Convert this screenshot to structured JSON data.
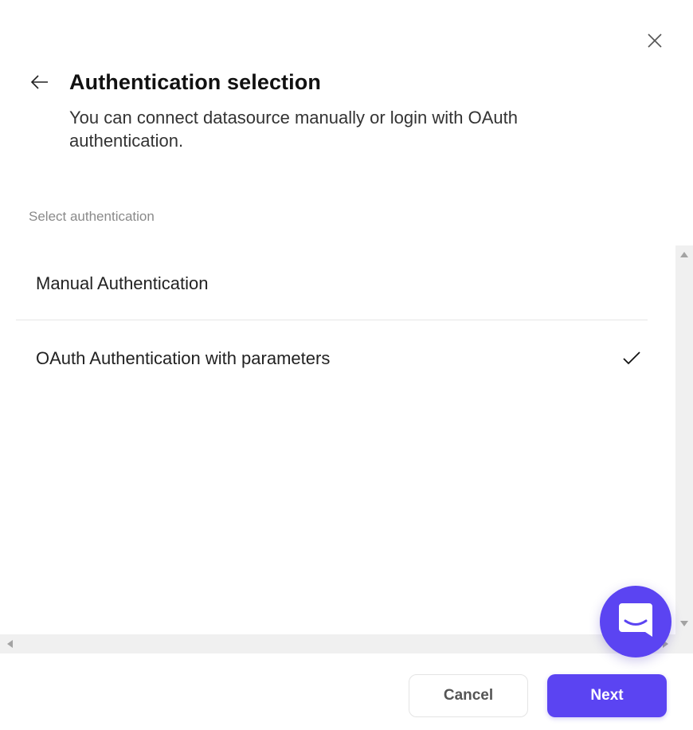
{
  "dialog": {
    "title": "Authentication selection",
    "subtitle": "You can connect datasource manually or login with OAuth authentication."
  },
  "section": {
    "label": "Select authentication"
  },
  "options": [
    {
      "label": "Manual Authentication",
      "selected": false
    },
    {
      "label": "OAuth Authentication with parameters",
      "selected": true
    }
  ],
  "footer": {
    "cancel_label": "Cancel",
    "next_label": "Next"
  },
  "icons": {
    "back": "arrow-left-icon",
    "close": "close-icon",
    "check": "checkmark-icon",
    "chat": "chat-bubble-icon"
  },
  "colors": {
    "accent": "#5b44f2",
    "divider": "#e6e6e6",
    "muted_text": "#8a8a8a"
  }
}
